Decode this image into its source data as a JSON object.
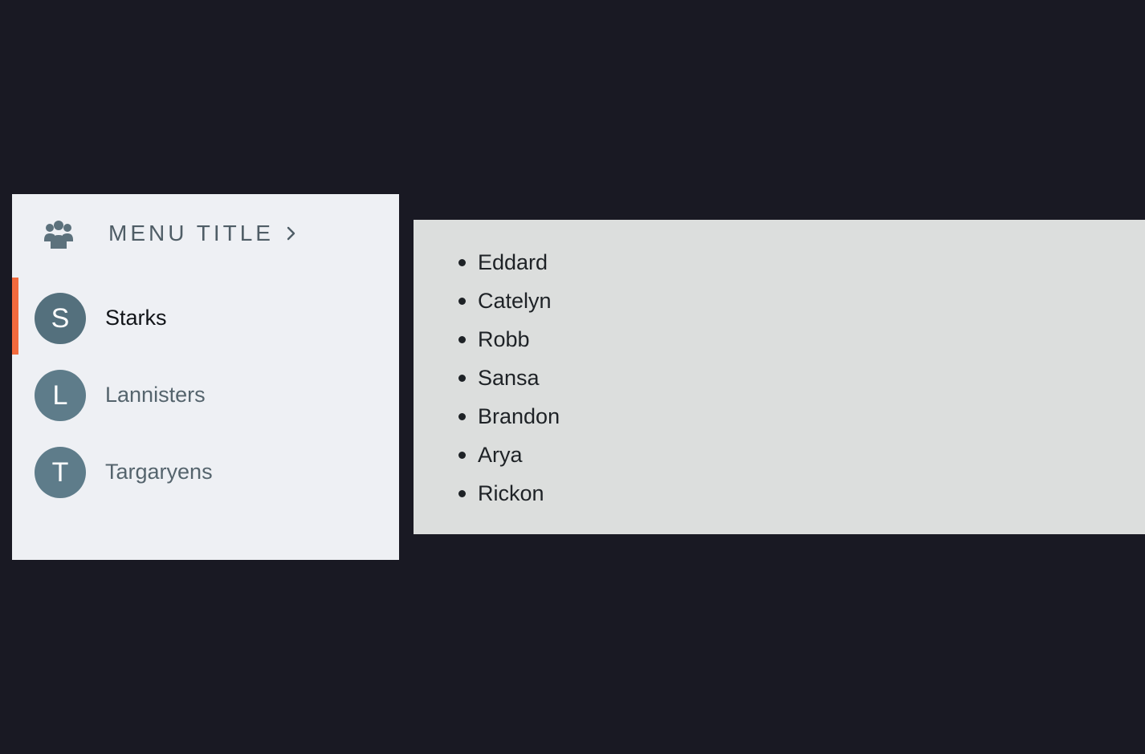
{
  "menu": {
    "title": "MENU TITLE",
    "header_icon": "users-group-icon",
    "chevron_icon": "chevron-right-icon",
    "accent_color": "#f26a3d",
    "items": [
      {
        "initial": "S",
        "label": "Starks",
        "active": true
      },
      {
        "initial": "L",
        "label": "Lannisters",
        "active": false
      },
      {
        "initial": "T",
        "label": "Targaryens",
        "active": false
      }
    ]
  },
  "content": {
    "names": [
      "Eddard",
      "Catelyn",
      "Robb",
      "Sansa",
      "Brandon",
      "Arya",
      "Rickon"
    ]
  }
}
